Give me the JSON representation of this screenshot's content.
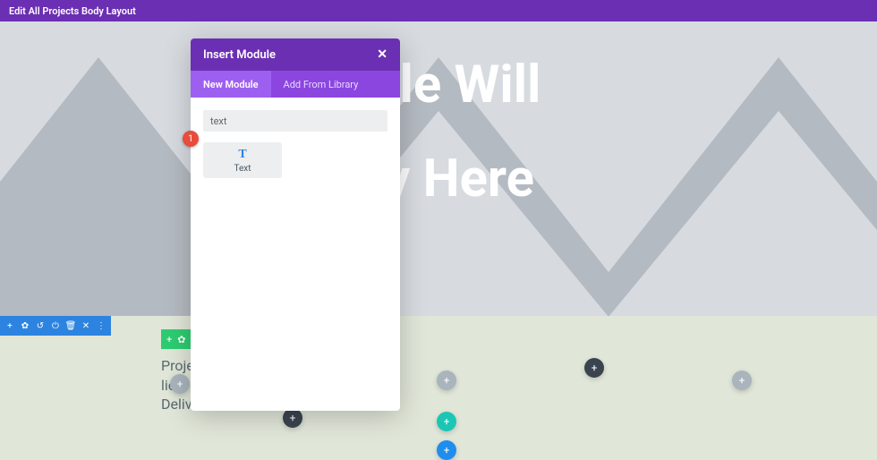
{
  "topbar": {
    "title": "Edit All Projects Body Layout"
  },
  "hero": {
    "line1": "Title Will",
    "line2": "lay Here"
  },
  "modal": {
    "title": "Insert Module",
    "tabs": {
      "new": "New Module",
      "library": "Add From Library"
    },
    "search_value": "text",
    "module_label": "Text",
    "module_icon": "T"
  },
  "project_text": {
    "l1": "Proje",
    "l2": "lien",
    "l3": "Deliv"
  },
  "section_toolbar": {
    "plus": "+",
    "gear": "✿",
    "undo": "↺",
    "power": "⏻",
    "trash": "🗑",
    "close": "✕",
    "more": "⋮"
  },
  "green_toolbar": {
    "plus": "+",
    "gear": "✿"
  },
  "badge": "1",
  "circles": {
    "plus": "+"
  }
}
